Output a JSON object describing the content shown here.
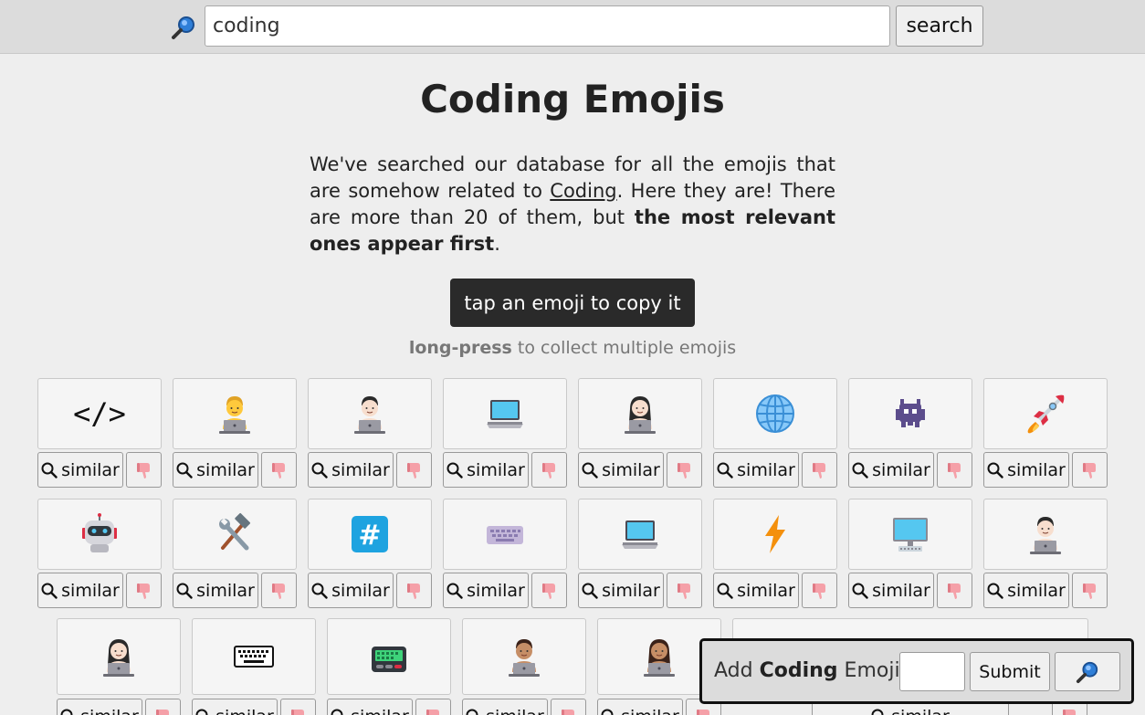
{
  "search": {
    "value": "coding",
    "button_label": "search"
  },
  "page": {
    "title": "Coding Emojis",
    "intro_1": "We've searched our database for all the emojis that are somehow related to ",
    "intro_link": "Coding",
    "intro_2": ". Here they are! There are more than 20 of them, but ",
    "intro_bold": "the most relevant ones appear first",
    "intro_3": "."
  },
  "copy_hint": "tap an emoji to copy it",
  "press_hint": {
    "bold": "long-press",
    "rest": " to collect multiple emojis"
  },
  "similar_label": "similar",
  "emojis": [
    {
      "name": "code-brackets"
    },
    {
      "name": "technologist"
    },
    {
      "name": "man-technologist"
    },
    {
      "name": "laptop"
    },
    {
      "name": "woman-technologist"
    },
    {
      "name": "globe-with-meridians"
    },
    {
      "name": "space-invader"
    },
    {
      "name": "rocket"
    },
    {
      "name": "robot"
    },
    {
      "name": "hammer-and-wrench"
    },
    {
      "name": "keycap-hash"
    },
    {
      "name": "keyboard"
    },
    {
      "name": "laptop"
    },
    {
      "name": "high-voltage"
    },
    {
      "name": "desktop-computer"
    },
    {
      "name": "man-technologist"
    },
    {
      "name": "woman-technologist"
    },
    {
      "name": "keyboard-outline"
    },
    {
      "name": "pager"
    },
    {
      "name": "man-technologist-medium"
    },
    {
      "name": "woman-technologist-medium"
    },
    {
      "name": "partial-emoji"
    }
  ],
  "add_form": {
    "prefix": "Add ",
    "bold": "Coding",
    "suffix": " Emoji:",
    "submit_label": "Submit"
  }
}
